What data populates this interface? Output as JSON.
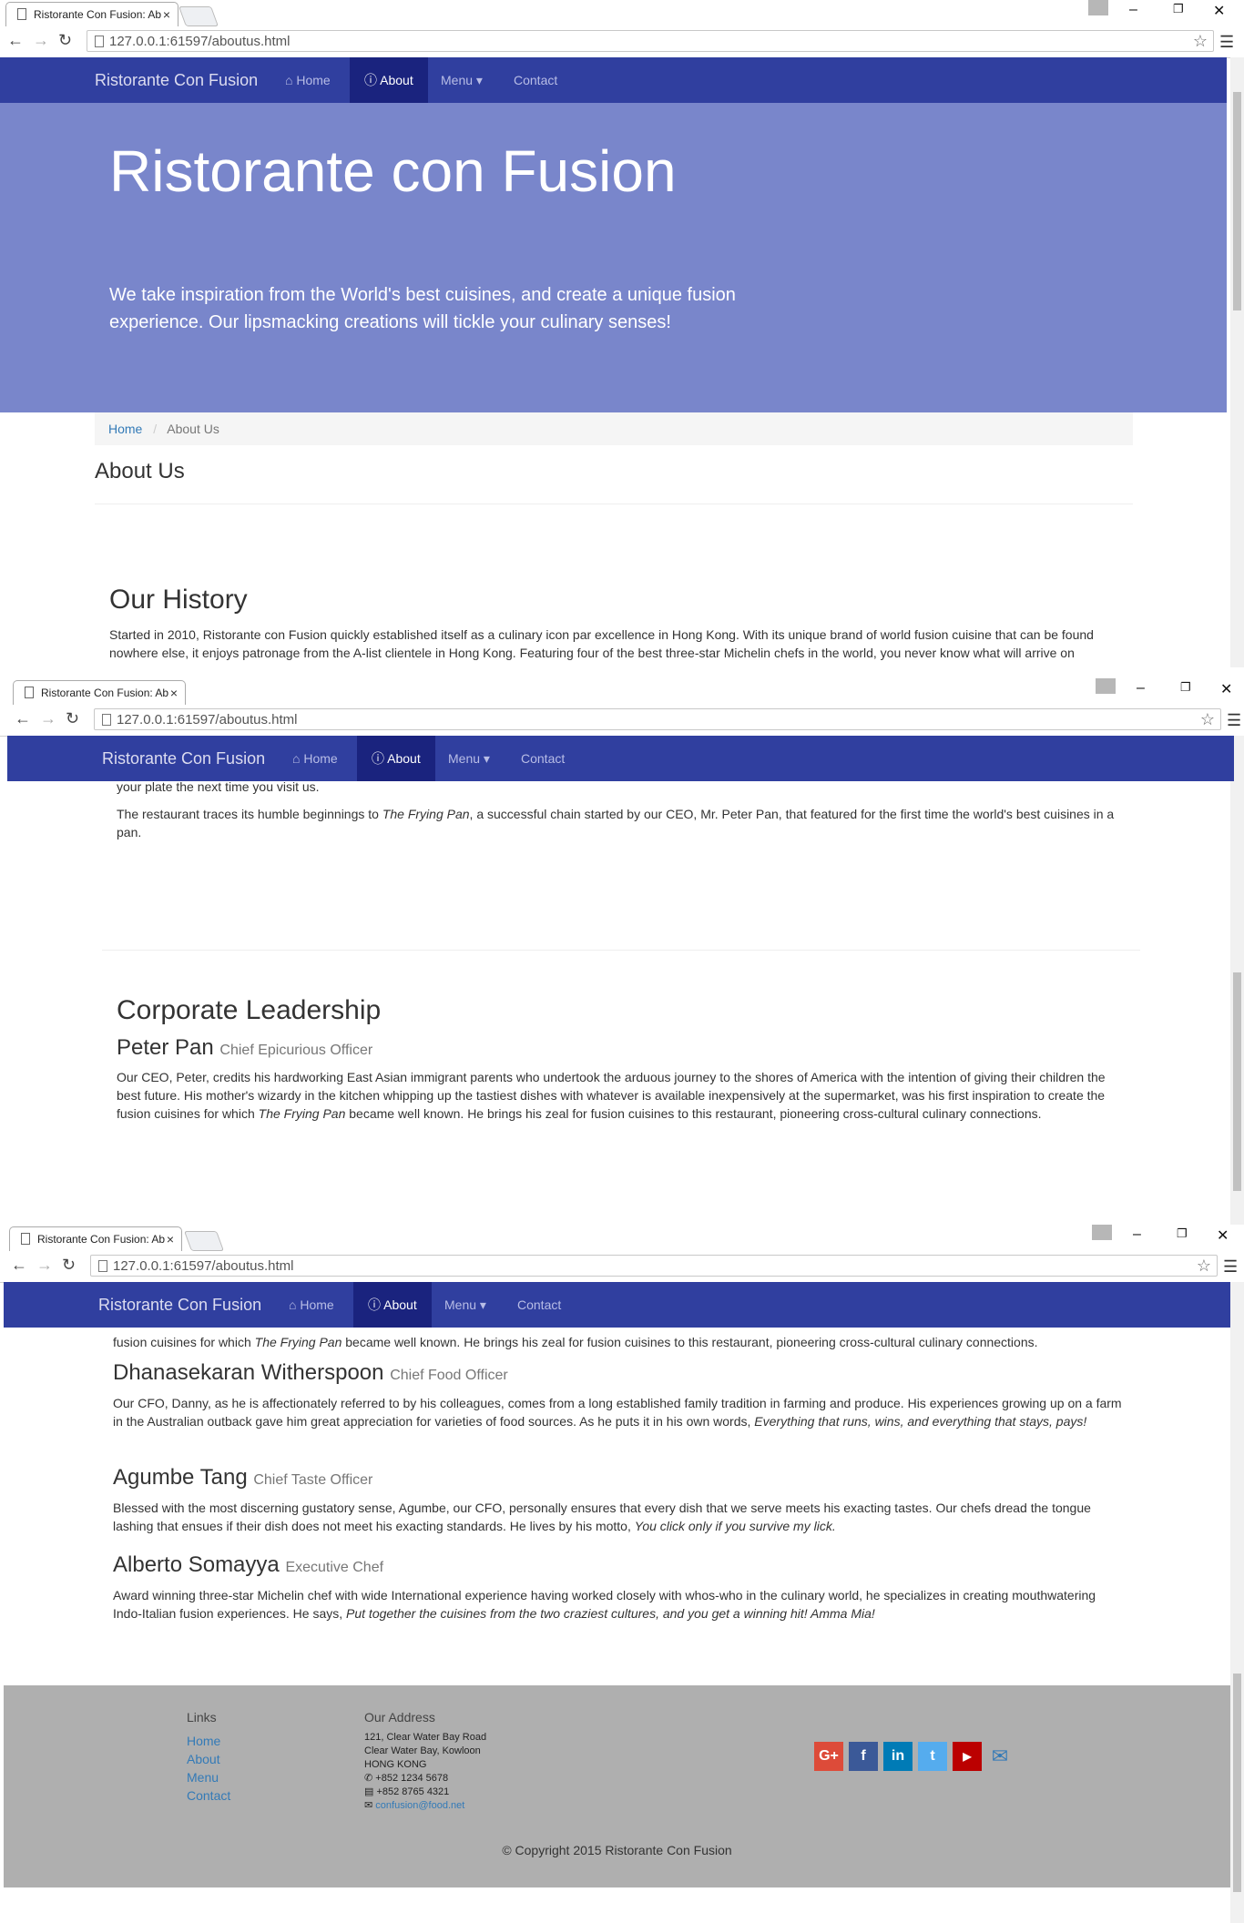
{
  "browser": {
    "tab_title": "Ristorante Con Fusion: Ab",
    "url": "127.0.0.1:61597/aboutus.html"
  },
  "navbar": {
    "brand": "Ristorante Con Fusion",
    "items": [
      {
        "label": "Home",
        "icon": "home-icon"
      },
      {
        "label": "About",
        "icon": "info-icon"
      },
      {
        "label": "Menu",
        "icon": "caret-down-icon"
      },
      {
        "label": "Contact"
      }
    ]
  },
  "jumbotron": {
    "title": "Ristorante con Fusion",
    "tagline": "We take inspiration from the World's best cuisines, and create a unique fusion experience. Our lipsmacking creations will tickle your culinary senses!"
  },
  "breadcrumb": {
    "home": "Home",
    "separator": "/",
    "current": "About Us"
  },
  "page_title": "About Us",
  "history": {
    "heading": "Our History",
    "p1": "Started in 2010, Ristorante con Fusion quickly established itself as a culinary icon par excellence in Hong Kong. With its unique brand of world fusion cuisine that can be found nowhere else, it enjoys patronage from the A-list clientele in Hong Kong. Featuring four of the best three-star Michelin chefs in the world, you never know what will arrive on",
    "p1_end": "your plate the next time you visit us.",
    "p2_pre": "The restaurant traces its humble beginnings to ",
    "p2_em": "The Frying Pan",
    "p2_post": ", a successful chain started by our CEO, Mr. Peter Pan, that featured for the first time the world's best cuisines in a pan."
  },
  "leadership": {
    "heading": "Corporate Leadership",
    "leaders": [
      {
        "name": "Peter Pan",
        "title": "Chief Epicurious Officer",
        "desc_pre": "Our CEO, Peter, credits his hardworking East Asian immigrant parents who undertook the arduous journey to the shores of America with the intention of giving their children the best future. His mother's wizardy in the kitchen whipping up the tastiest dishes with whatever is available inexpensively at the supermarket, was his first inspiration to create the fusion cuisines for which ",
        "desc_em": "The Frying Pan",
        "desc_post": " became well known. He brings his zeal for fusion cuisines to this restaurant, pioneering cross-cultural culinary connections.",
        "tail_pre": "fusion cuisines for which ",
        "tail_post": " became well known. He brings his zeal for fusion cuisines to this restaurant, pioneering cross-cultural culinary connections."
      },
      {
        "name": "Dhanasekaran Witherspoon",
        "title": "Chief Food Officer",
        "desc_pre": "Our CFO, Danny, as he is affectionately referred to by his colleagues, comes from a long established family tradition in farming and produce. His experiences growing up on a farm in the Australian outback gave him great appreciation for varieties of food sources. As he puts it in his own words, ",
        "desc_em": "Everything that runs, wins, and everything that stays, pays!",
        "desc_post": ""
      },
      {
        "name": "Agumbe Tang",
        "title": "Chief Taste Officer",
        "desc_pre": "Blessed with the most discerning gustatory sense, Agumbe, our CFO, personally ensures that every dish that we serve meets his exacting tastes. Our chefs dread the tongue lashing that ensues if their dish does not meet his exacting standards. He lives by his motto, ",
        "desc_em": "You click only if you survive my lick.",
        "desc_post": ""
      },
      {
        "name": "Alberto Somayya",
        "title": "Executive Chef",
        "desc_pre": "Award winning three-star Michelin chef with wide International experience having worked closely with whos-who in the culinary world, he specializes in creating mouthwatering Indo-Italian fusion experiences. He says, ",
        "desc_em": "Put together the cuisines from the two craziest cultures, and you get a winning hit! Amma Mia!",
        "desc_post": ""
      }
    ]
  },
  "footer": {
    "links_heading": "Links",
    "links": [
      "Home",
      "About",
      "Menu",
      "Contact"
    ],
    "address_heading": "Our Address",
    "address_lines": [
      "121, Clear Water Bay Road",
      "Clear Water Bay, Kowloon",
      "HONG KONG"
    ],
    "phone": "+852 1234 5678",
    "fax": "+852 8765 4321",
    "email": "confusion@food.net",
    "social": [
      {
        "icon": "google-plus-icon",
        "label": "G+",
        "color": "#dd4b39"
      },
      {
        "icon": "facebook-icon",
        "label": "f",
        "color": "#3b5998"
      },
      {
        "icon": "linkedin-icon",
        "label": "in",
        "color": "#007bb6"
      },
      {
        "icon": "twitter-icon",
        "label": "t",
        "color": "#55acee"
      },
      {
        "icon": "youtube-icon",
        "label": "▶",
        "color": "#bb0000"
      },
      {
        "icon": "mail-icon",
        "label": "✉",
        "color": "#337ab7"
      }
    ],
    "copyright": "© Copyright 2015 Ristorante Con Fusion"
  },
  "colors": {
    "navbar": "#303f9f",
    "navbar_active": "#1a237e",
    "jumbotron": "#7986cb",
    "footer": "#afafaf",
    "link": "#337ab7"
  }
}
